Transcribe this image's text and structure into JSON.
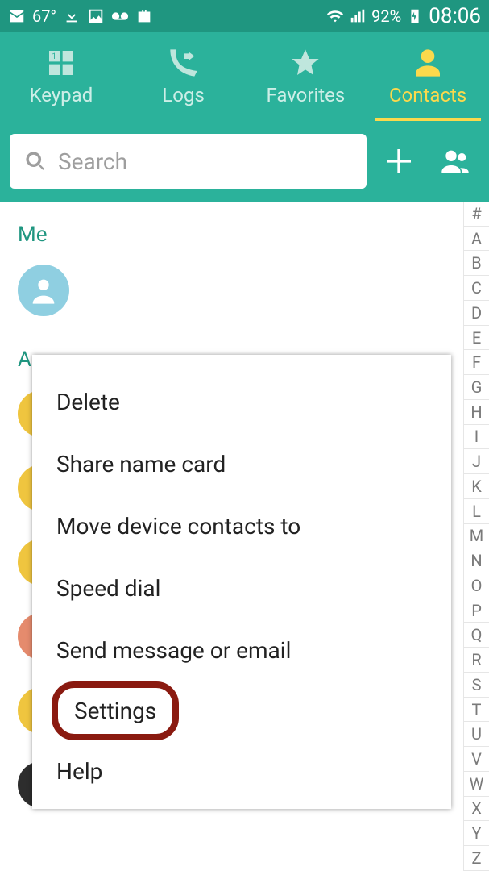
{
  "statusbar": {
    "temperature": "67°",
    "battery_pct": "92%",
    "time": "08:06"
  },
  "tabs": {
    "keypad": "Keypad",
    "logs": "Logs",
    "favorites": "Favorites",
    "contacts": "Contacts"
  },
  "search": {
    "placeholder": "Search"
  },
  "sections": {
    "me": "Me",
    "a": "A"
  },
  "menu": {
    "delete": "Delete",
    "share": "Share name card",
    "move": "Move device contacts to",
    "speed": "Speed dial",
    "send": "Send message or email",
    "settings": "Settings",
    "help": "Help"
  },
  "index": [
    "#",
    "A",
    "B",
    "C",
    "D",
    "E",
    "F",
    "G",
    "H",
    "I",
    "J",
    "K",
    "L",
    "M",
    "N",
    "O",
    "P",
    "Q",
    "R",
    "S",
    "T",
    "U",
    "V",
    "W",
    "X",
    "Y",
    "Z"
  ]
}
